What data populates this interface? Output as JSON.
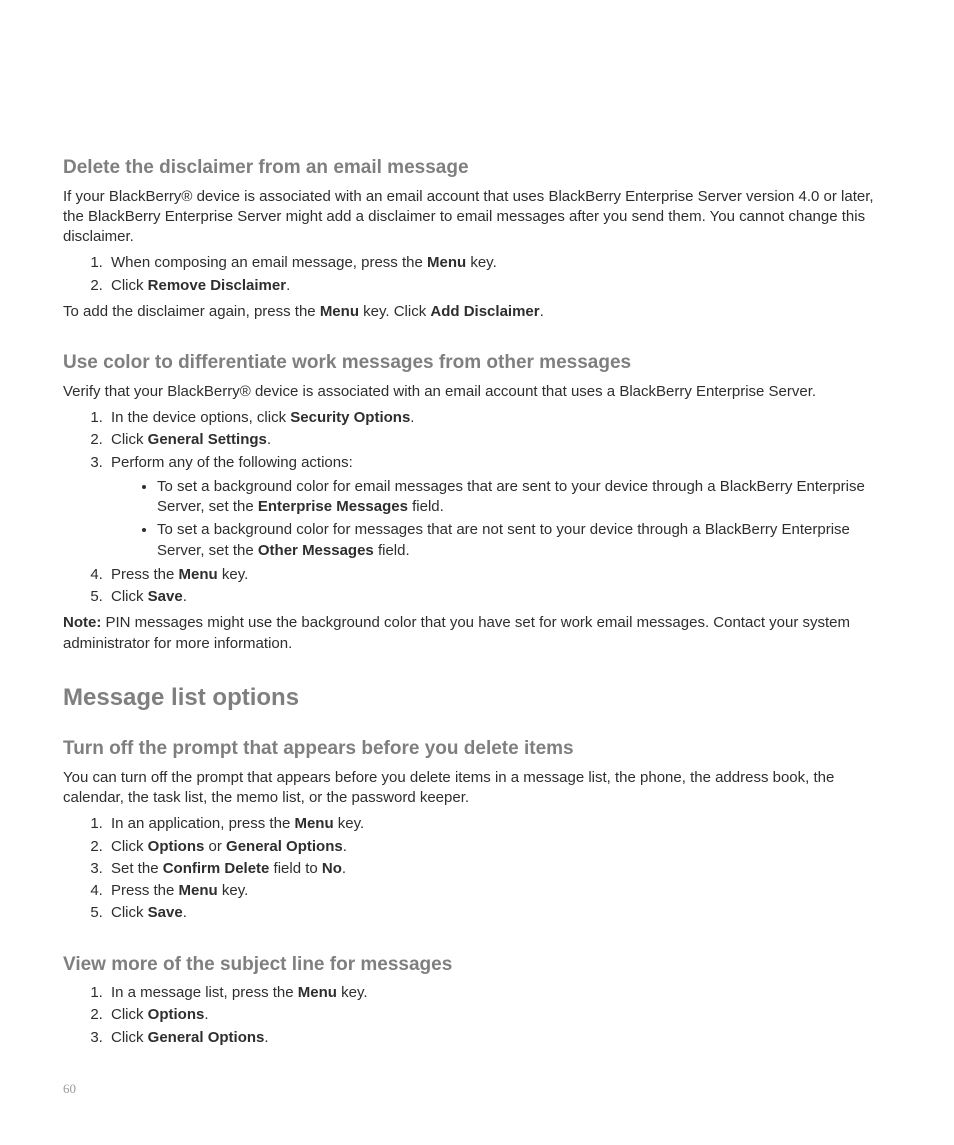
{
  "section1": {
    "heading": "Delete the disclaimer from an email message",
    "intro": "If your BlackBerry® device is associated with an email account that uses BlackBerry Enterprise Server version 4.0 or later, the BlackBerry Enterprise Server might add a disclaimer to email messages after you send them. You cannot change this disclaimer.",
    "step1_a": "When composing an email message, press the ",
    "step1_b": "Menu",
    "step1_c": " key.",
    "step2_a": "Click ",
    "step2_b": "Remove Disclaimer",
    "step2_c": ".",
    "after_a": "To add the disclaimer again, press the ",
    "after_b": "Menu",
    "after_c": " key. Click ",
    "after_d": "Add Disclaimer",
    "after_e": "."
  },
  "section2": {
    "heading": "Use color to differentiate work messages from other messages",
    "intro": "Verify that your BlackBerry® device is associated with an email account that uses a BlackBerry Enterprise Server.",
    "s1_a": "In the device options, click ",
    "s1_b": "Security Options",
    "s1_c": ".",
    "s2_a": "Click ",
    "s2_b": "General Settings",
    "s2_c": ".",
    "s3": "Perform any of the following actions:",
    "b1_a": "To set a background color for email messages that are sent to your device through a BlackBerry Enterprise Server, set the ",
    "b1_b": "Enterprise Messages",
    "b1_c": " field.",
    "b2_a": "To set a background color for messages that are not sent to your device through a BlackBerry Enterprise Server, set the ",
    "b2_b": "Other Messages",
    "b2_c": " field.",
    "s4_a": "Press the ",
    "s4_b": "Menu",
    "s4_c": " key.",
    "s5_a": "Click ",
    "s5_b": "Save",
    "s5_c": ".",
    "note_label": "Note:",
    "note_body": "  PIN messages might use the background color that you have set for work email messages. Contact your system administrator for more information."
  },
  "section3": {
    "heading": "Message list options",
    "sub1": {
      "heading": "Turn off the prompt that appears before you delete items",
      "intro": "You can turn off the prompt that appears before you delete items in a message list, the phone, the address book, the calendar, the task list, the memo list, or the password keeper.",
      "s1_a": "In an application, press the ",
      "s1_b": "Menu",
      "s1_c": " key.",
      "s2_a": "Click ",
      "s2_b": "Options",
      "s2_c": " or ",
      "s2_d": "General Options",
      "s2_e": ".",
      "s3_a": "Set the ",
      "s3_b": "Confirm Delete",
      "s3_c": " field to ",
      "s3_d": "No",
      "s3_e": ".",
      "s4_a": "Press the ",
      "s4_b": "Menu",
      "s4_c": " key.",
      "s5_a": "Click ",
      "s5_b": "Save",
      "s5_c": "."
    },
    "sub2": {
      "heading": "View more of the subject line for messages",
      "s1_a": "In a message list, press the ",
      "s1_b": "Menu",
      "s1_c": " key.",
      "s2_a": "Click ",
      "s2_b": "Options",
      "s2_c": ".",
      "s3_a": "Click ",
      "s3_b": "General Options",
      "s3_c": "."
    }
  },
  "page_number": "60"
}
